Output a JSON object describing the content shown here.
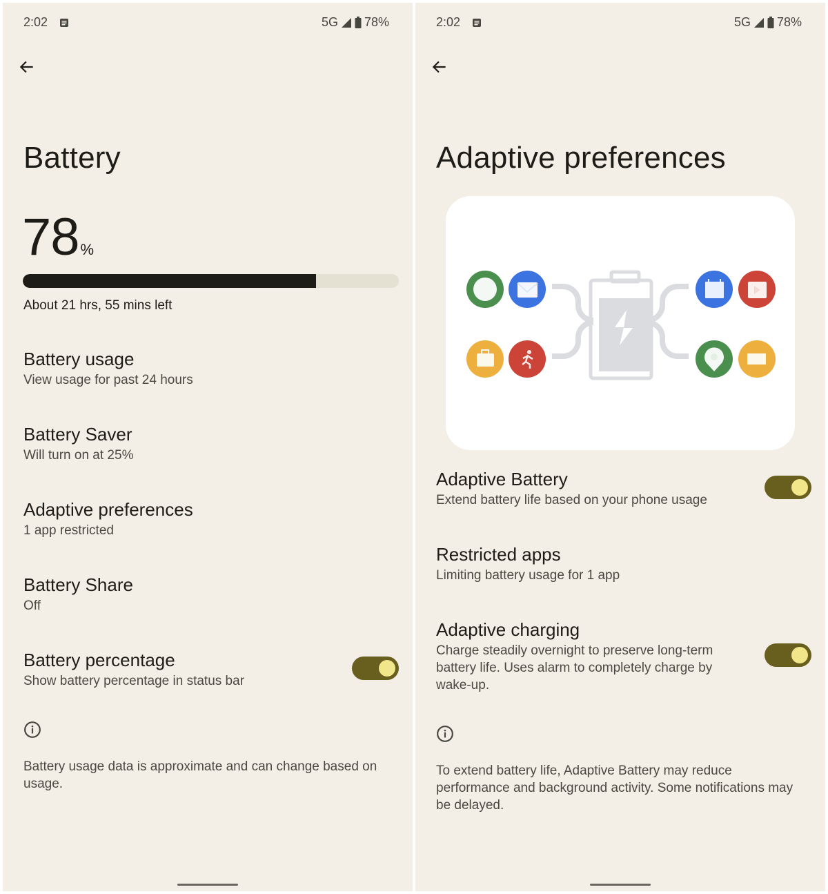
{
  "status_bar": {
    "time": "2:02",
    "network": "5G",
    "battery": "78%"
  },
  "battery_screen": {
    "title": "Battery",
    "level_value": "78",
    "level_unit": "%",
    "level_fraction": 0.78,
    "estimate": "About 21 hrs, 55 mins left",
    "items": [
      {
        "title": "Battery usage",
        "subtitle": "View usage for past 24 hours"
      },
      {
        "title": "Battery Saver",
        "subtitle": "Will turn on at 25%"
      },
      {
        "title": "Adaptive preferences",
        "subtitle": "1 app restricted"
      },
      {
        "title": "Battery Share",
        "subtitle": "Off"
      },
      {
        "title": "Battery percentage",
        "subtitle": "Show battery percentage in status bar",
        "toggle_on": true
      }
    ],
    "footer": "Battery usage data is approximate and can change based on usage."
  },
  "adaptive_screen": {
    "title": "Adaptive preferences",
    "illustration": {
      "left_apps": [
        "messages-icon",
        "mail-icon",
        "briefcase-icon",
        "fitness-icon"
      ],
      "right_apps": [
        "calendar-icon",
        "video-icon",
        "maps-icon",
        "ticket-icon"
      ],
      "center": "charging-battery-icon"
    },
    "items": [
      {
        "title": "Adaptive Battery",
        "subtitle": "Extend battery life based on your phone usage",
        "toggle_on": true
      },
      {
        "title": "Restricted apps",
        "subtitle": "Limiting battery usage for 1 app"
      },
      {
        "title": "Adaptive charging",
        "subtitle": "Charge steadily overnight to preserve long-term battery life. Uses alarm to completely charge by wake-up.",
        "toggle_on": true
      }
    ],
    "footer": "To extend battery life, Adaptive Battery may reduce performance and background activity. Some notifications may be delayed."
  },
  "colors": {
    "background": "#f3efe7",
    "toggle_track": "#685f1f",
    "toggle_thumb": "#f1e68a",
    "bar_fill": "#1e1c16",
    "bar_track": "#e5e1d2"
  }
}
